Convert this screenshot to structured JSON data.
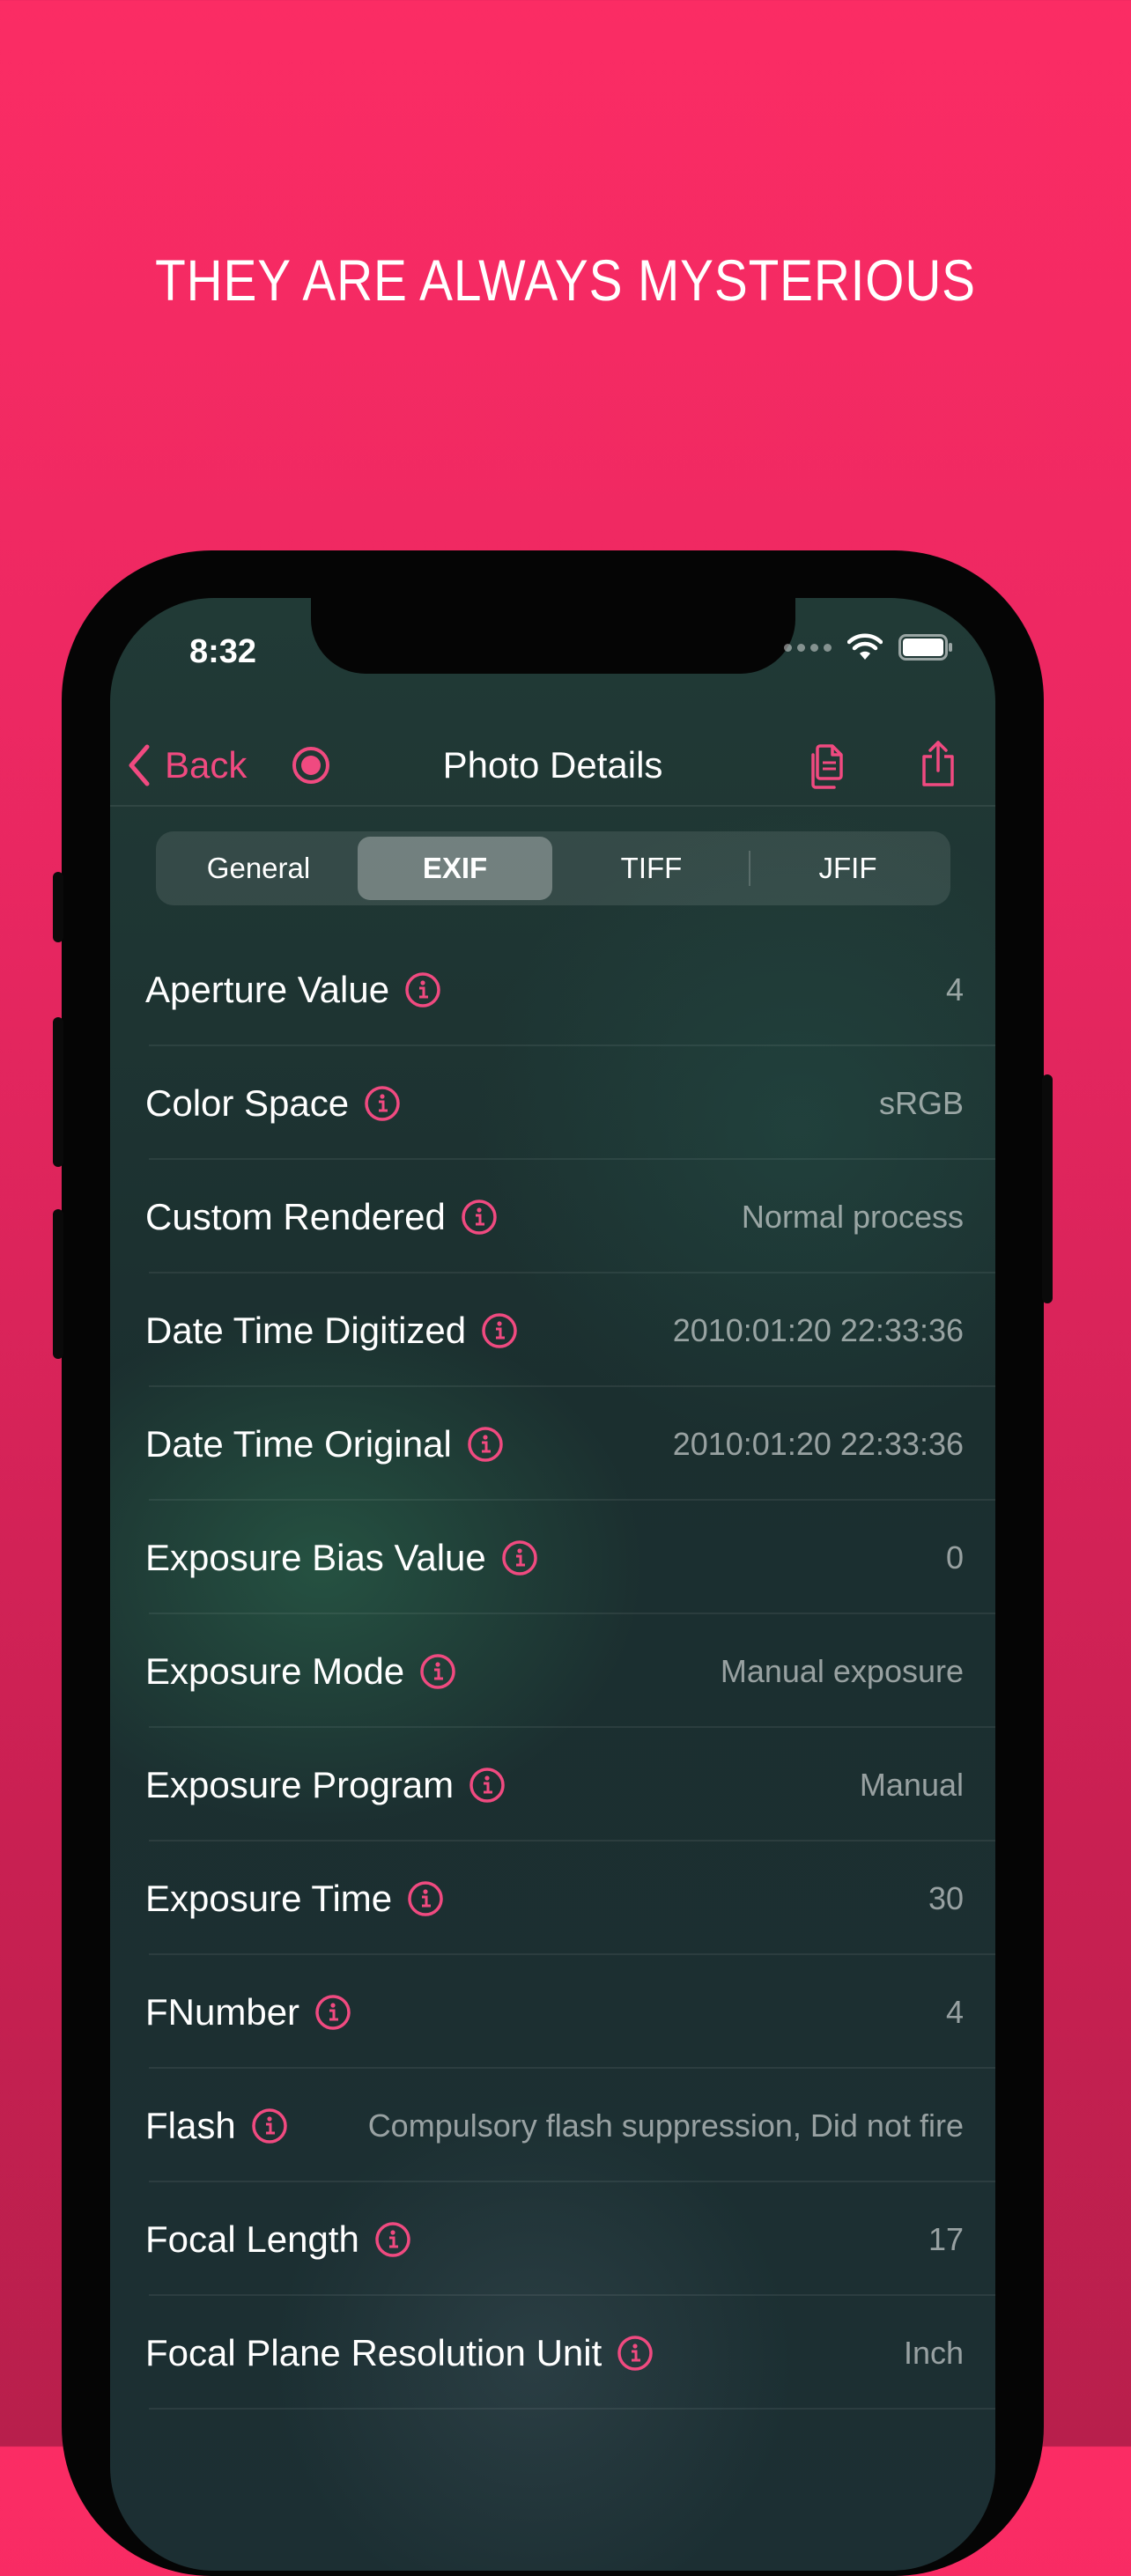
{
  "headline": "THEY ARE ALWAYS MYSTERIOUS",
  "status_bar": {
    "time": "8:32"
  },
  "nav": {
    "back_label": "Back",
    "title": "Photo Details",
    "icons": [
      "chevron-left-icon",
      "record-icon",
      "copy-icon",
      "share-icon"
    ]
  },
  "tabs": [
    {
      "label": "General",
      "selected": false
    },
    {
      "label": "EXIF",
      "selected": true
    },
    {
      "label": "TIFF",
      "selected": false
    },
    {
      "label": "JFIF",
      "selected": false
    }
  ],
  "rows": [
    {
      "label": "Aperture Value",
      "value": "4"
    },
    {
      "label": "Color Space",
      "value": "sRGB"
    },
    {
      "label": "Custom Rendered",
      "value": "Normal process"
    },
    {
      "label": "Date Time Digitized",
      "value": "2010:01:20 22:33:36"
    },
    {
      "label": "Date Time Original",
      "value": "2010:01:20 22:33:36"
    },
    {
      "label": "Exposure Bias Value",
      "value": "0"
    },
    {
      "label": "Exposure Mode",
      "value": "Manual exposure"
    },
    {
      "label": "Exposure Program",
      "value": "Manual"
    },
    {
      "label": "Exposure Time",
      "value": "30"
    },
    {
      "label": "FNumber",
      "value": "4"
    },
    {
      "label": "Flash",
      "value": "Compulsory flash suppression, Did not fire"
    },
    {
      "label": "Focal Length",
      "value": "17"
    },
    {
      "label": "Focal Plane Resolution Unit",
      "value": "Inch"
    }
  ],
  "colors": {
    "accent": "#f04a80",
    "background_top": "#fb2c64",
    "background_bottom": "#b81f4c"
  }
}
